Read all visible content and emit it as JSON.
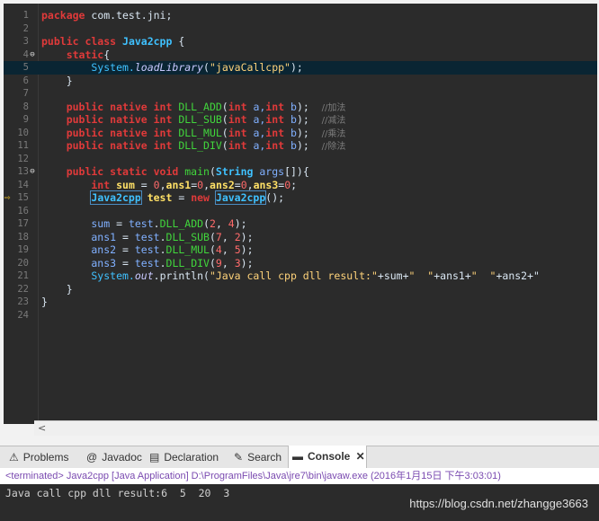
{
  "editor": {
    "lines": [
      {
        "n": "1",
        "tokens": [
          {
            "t": "package ",
            "c": "kw"
          },
          {
            "t": "com.test.jni;",
            "c": "plain"
          }
        ]
      },
      {
        "n": "2",
        "tokens": []
      },
      {
        "n": "3",
        "tokens": [
          {
            "t": "public class ",
            "c": "kw"
          },
          {
            "t": "Java2cpp",
            "c": "cls"
          },
          {
            "t": " {",
            "c": "plain"
          }
        ]
      },
      {
        "n": "4",
        "marker": "fold",
        "tokens": [
          {
            "t": "    static",
            "c": "kw"
          },
          {
            "t": "{",
            "c": "plain"
          }
        ]
      },
      {
        "n": "5",
        "current": true,
        "tokens": [
          {
            "t": "        System.",
            "c": "sys"
          },
          {
            "t": "loadLibrary",
            "c": "ital"
          },
          {
            "t": "(",
            "c": "plain"
          },
          {
            "t": "\"javaCallcpp\"",
            "c": "str"
          },
          {
            "t": ");",
            "c": "plain"
          }
        ]
      },
      {
        "n": "6",
        "tokens": [
          {
            "t": "    }",
            "c": "plain"
          }
        ]
      },
      {
        "n": "7",
        "tokens": []
      },
      {
        "n": "8",
        "tokens": [
          {
            "t": "    public native int ",
            "c": "kw"
          },
          {
            "t": "DLL_ADD",
            "c": "meth"
          },
          {
            "t": "(",
            "c": "plain"
          },
          {
            "t": "int ",
            "c": "kw"
          },
          {
            "t": "a,",
            "c": "param"
          },
          {
            "t": "int ",
            "c": "kw"
          },
          {
            "t": "b",
            "c": "param"
          },
          {
            "t": ");  ",
            "c": "plain"
          },
          {
            "t": "//加法",
            "c": "cmt"
          }
        ]
      },
      {
        "n": "9",
        "tokens": [
          {
            "t": "    public native int ",
            "c": "kw"
          },
          {
            "t": "DLL_SUB",
            "c": "meth"
          },
          {
            "t": "(",
            "c": "plain"
          },
          {
            "t": "int ",
            "c": "kw"
          },
          {
            "t": "a,",
            "c": "param"
          },
          {
            "t": "int ",
            "c": "kw"
          },
          {
            "t": "b",
            "c": "param"
          },
          {
            "t": ");  ",
            "c": "plain"
          },
          {
            "t": "//减法",
            "c": "cmt"
          }
        ]
      },
      {
        "n": "10",
        "tokens": [
          {
            "t": "    public native int ",
            "c": "kw"
          },
          {
            "t": "DLL_MUL",
            "c": "meth"
          },
          {
            "t": "(",
            "c": "plain"
          },
          {
            "t": "int ",
            "c": "kw"
          },
          {
            "t": "a,",
            "c": "param"
          },
          {
            "t": "int ",
            "c": "kw"
          },
          {
            "t": "b",
            "c": "param"
          },
          {
            "t": ");  ",
            "c": "plain"
          },
          {
            "t": "//乘法",
            "c": "cmt"
          }
        ]
      },
      {
        "n": "11",
        "tokens": [
          {
            "t": "    public native int ",
            "c": "kw"
          },
          {
            "t": "DLL_DIV",
            "c": "meth"
          },
          {
            "t": "(",
            "c": "plain"
          },
          {
            "t": "int ",
            "c": "kw"
          },
          {
            "t": "a,",
            "c": "param"
          },
          {
            "t": "int ",
            "c": "kw"
          },
          {
            "t": "b",
            "c": "param"
          },
          {
            "t": ");  ",
            "c": "plain"
          },
          {
            "t": "//除法",
            "c": "cmt"
          }
        ]
      },
      {
        "n": "12",
        "tokens": []
      },
      {
        "n": "13",
        "marker": "fold",
        "tokens": [
          {
            "t": "    public static void ",
            "c": "kw"
          },
          {
            "t": "main",
            "c": "meth"
          },
          {
            "t": "(",
            "c": "plain"
          },
          {
            "t": "String ",
            "c": "cls"
          },
          {
            "t": "args",
            "c": "param"
          },
          {
            "t": "[]){",
            "c": "plain"
          }
        ]
      },
      {
        "n": "14",
        "tokens": [
          {
            "t": "        int ",
            "c": "kw"
          },
          {
            "t": "sum",
            "c": "var"
          },
          {
            "t": " = ",
            "c": "plain"
          },
          {
            "t": "0",
            "c": "num"
          },
          {
            "t": ",",
            "c": "plain"
          },
          {
            "t": "ans1",
            "c": "var"
          },
          {
            "t": "=",
            "c": "plain"
          },
          {
            "t": "0",
            "c": "num"
          },
          {
            "t": ",",
            "c": "plain"
          },
          {
            "t": "ans2",
            "c": "var"
          },
          {
            "t": "=",
            "c": "plain"
          },
          {
            "t": "0",
            "c": "num"
          },
          {
            "t": ",",
            "c": "plain"
          },
          {
            "t": "ans3",
            "c": "var"
          },
          {
            "t": "=",
            "c": "plain"
          },
          {
            "t": "0",
            "c": "num"
          },
          {
            "t": ";",
            "c": "plain"
          }
        ]
      },
      {
        "n": "15",
        "marker": "arrow",
        "tokens": [
          {
            "t": "        ",
            "c": "plain"
          },
          {
            "t": "Java2cpp",
            "c": "cls",
            "box": true
          },
          {
            "t": " test",
            "c": "var"
          },
          {
            "t": " = ",
            "c": "plain"
          },
          {
            "t": "new ",
            "c": "kw"
          },
          {
            "t": "Java2cpp",
            "c": "cls",
            "box": true
          },
          {
            "t": "();",
            "c": "plain"
          }
        ]
      },
      {
        "n": "16",
        "tokens": []
      },
      {
        "n": "17",
        "tokens": [
          {
            "t": "        sum",
            "c": "param"
          },
          {
            "t": " = ",
            "c": "plain"
          },
          {
            "t": "test",
            "c": "param"
          },
          {
            "t": ".",
            "c": "plain"
          },
          {
            "t": "DLL_ADD",
            "c": "meth"
          },
          {
            "t": "(",
            "c": "plain"
          },
          {
            "t": "2",
            "c": "num"
          },
          {
            "t": ", ",
            "c": "plain"
          },
          {
            "t": "4",
            "c": "num"
          },
          {
            "t": ");",
            "c": "plain"
          }
        ]
      },
      {
        "n": "18",
        "tokens": [
          {
            "t": "        ans1",
            "c": "param"
          },
          {
            "t": " = ",
            "c": "plain"
          },
          {
            "t": "test",
            "c": "param"
          },
          {
            "t": ".",
            "c": "plain"
          },
          {
            "t": "DLL_SUB",
            "c": "meth"
          },
          {
            "t": "(",
            "c": "plain"
          },
          {
            "t": "7",
            "c": "num"
          },
          {
            "t": ", ",
            "c": "plain"
          },
          {
            "t": "2",
            "c": "num"
          },
          {
            "t": ");",
            "c": "plain"
          }
        ]
      },
      {
        "n": "19",
        "tokens": [
          {
            "t": "        ans2",
            "c": "param"
          },
          {
            "t": " = ",
            "c": "plain"
          },
          {
            "t": "test",
            "c": "param"
          },
          {
            "t": ".",
            "c": "plain"
          },
          {
            "t": "DLL_MUL",
            "c": "meth"
          },
          {
            "t": "(",
            "c": "plain"
          },
          {
            "t": "4",
            "c": "num"
          },
          {
            "t": ", ",
            "c": "plain"
          },
          {
            "t": "5",
            "c": "num"
          },
          {
            "t": ");",
            "c": "plain"
          }
        ]
      },
      {
        "n": "20",
        "tokens": [
          {
            "t": "        ans3",
            "c": "param"
          },
          {
            "t": " = ",
            "c": "plain"
          },
          {
            "t": "test",
            "c": "param"
          },
          {
            "t": ".",
            "c": "plain"
          },
          {
            "t": "DLL_DIV",
            "c": "meth"
          },
          {
            "t": "(",
            "c": "plain"
          },
          {
            "t": "9",
            "c": "num"
          },
          {
            "t": ", ",
            "c": "plain"
          },
          {
            "t": "3",
            "c": "num"
          },
          {
            "t": ");",
            "c": "plain"
          }
        ]
      },
      {
        "n": "21",
        "tokens": [
          {
            "t": "        System.",
            "c": "sys"
          },
          {
            "t": "out",
            "c": "ital"
          },
          {
            "t": ".println(",
            "c": "plain"
          },
          {
            "t": "\"Java call cpp dll result:\"",
            "c": "str"
          },
          {
            "t": "+sum+",
            "c": "plain"
          },
          {
            "t": "\"  \"",
            "c": "str"
          },
          {
            "t": "+ans1+",
            "c": "plain"
          },
          {
            "t": "\"  \"",
            "c": "str"
          },
          {
            "t": "+ans2+\"",
            "c": "plain"
          }
        ]
      },
      {
        "n": "22",
        "tokens": [
          {
            "t": "    }",
            "c": "plain"
          }
        ]
      },
      {
        "n": "23",
        "tokens": [
          {
            "t": "}",
            "c": "plain"
          }
        ]
      },
      {
        "n": "24",
        "tokens": []
      }
    ]
  },
  "scrollbar": {
    "left_arrow": "<"
  },
  "tabs": [
    {
      "label": "Problems",
      "icon": "problems-icon",
      "glyph": "⚠",
      "active": false
    },
    {
      "label": "Javadoc",
      "icon": "javadoc-icon",
      "glyph": "@",
      "active": false
    },
    {
      "label": "Declaration",
      "icon": "declaration-icon",
      "glyph": "▤",
      "active": false
    },
    {
      "label": "Search",
      "icon": "search-icon",
      "glyph": "✎",
      "active": false
    },
    {
      "label": "Console",
      "icon": "console-icon",
      "glyph": "▬",
      "active": true,
      "close": "✕"
    }
  ],
  "status": "<terminated> Java2cpp [Java Application] D:\\ProgramFiles\\Java\\jre7\\bin\\javaw.exe (2016年1月15日 下午3:03:01)",
  "console_output": "Java call cpp dll result:6  5  20  3",
  "watermark": "https://blog.csdn.net/zhangge3663"
}
